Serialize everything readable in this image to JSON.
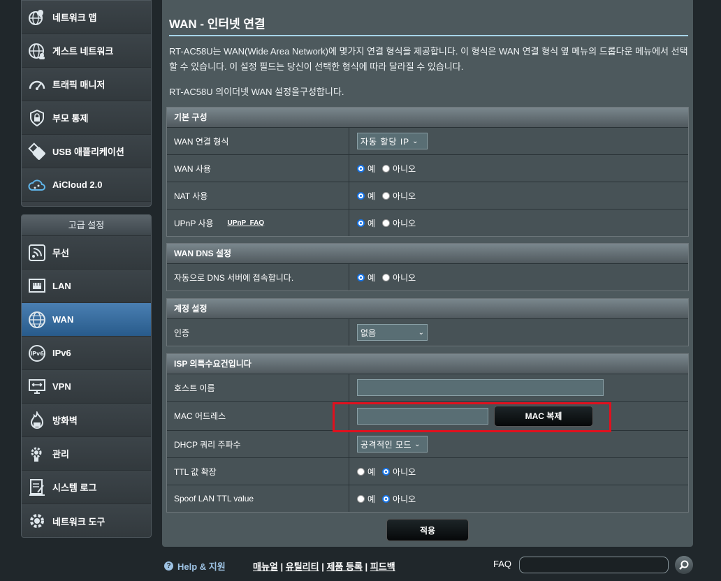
{
  "sidebar": {
    "general_items": [
      {
        "label": "네트워크 맵",
        "icon": "network-map-icon"
      },
      {
        "label": "게스트 네트워크",
        "icon": "guest-network-icon"
      },
      {
        "label": "트래픽 매니저",
        "icon": "traffic-manager-icon"
      },
      {
        "label": "부모 통제",
        "icon": "parental-control-icon"
      },
      {
        "label": "USB 애플리케이션",
        "icon": "usb-application-icon"
      },
      {
        "label": "AiCloud 2.0",
        "icon": "aicloud-icon"
      }
    ],
    "advanced_header": "고급 설정",
    "advanced_items": [
      {
        "label": "무선",
        "icon": "wireless-icon"
      },
      {
        "label": "LAN",
        "icon": "lan-icon"
      },
      {
        "label": "WAN",
        "icon": "wan-globe-icon",
        "active": true
      },
      {
        "label": "IPv6",
        "icon": "ipv6-icon"
      },
      {
        "label": "VPN",
        "icon": "vpn-icon"
      },
      {
        "label": "방화벽",
        "icon": "firewall-icon"
      },
      {
        "label": "관리",
        "icon": "administration-icon"
      },
      {
        "label": "시스템 로그",
        "icon": "system-log-icon"
      },
      {
        "label": "네트워크 도구",
        "icon": "network-tools-icon"
      }
    ]
  },
  "main": {
    "title": "WAN - 인터넷 연결",
    "description": "RT-AC58U는 WAN(Wide Area Network)에 몇가지 연결 형식을 제공합니다. 이 형식은 WAN 연결 형식 옆 메뉴의 드롭다운 메뉴에서 선택할 수 있습니다. 이 설정 필드는 당신이 선택한 형식에 따라 달라질 수 있습니다.",
    "subdescription": "RT-AC58U 의이더넷 WAN 설정을구성합니다.",
    "basic": {
      "header": "기본 구성",
      "wan_type_label": "WAN 연결 형식",
      "wan_type_value": "자동 할당 IP",
      "wan_enable_label": "WAN 사용",
      "nat_label": "NAT 사용",
      "upnp_label": "UPnP 사용",
      "upnp_faq": "UPnP  FAQ"
    },
    "dns": {
      "header": "WAN DNS 설정",
      "auto_dns_label": "자동으로 DNS 서버에 접속합니다."
    },
    "account": {
      "header": "계정 설정",
      "auth_label": "인증",
      "auth_value": "없음"
    },
    "isp": {
      "header": "ISP 의특수요건입니다",
      "hostname_label": "호스트 이름",
      "hostname_value": "",
      "mac_label": "MAC 어드레스",
      "mac_value": "",
      "mac_clone_button": "MAC 복제",
      "dhcp_label": "DHCP 쿼리 주파수",
      "dhcp_value": "공격적인 모드",
      "ttl_label": "TTL 값 확장",
      "spoof_label": "Spoof LAN TTL value"
    },
    "radio_yes": "예",
    "radio_no": "아니오",
    "apply_button": "적용"
  },
  "footer": {
    "help": "Help & 지원",
    "manual": "매뉴얼",
    "utility": "유틸리티",
    "register": "제품 등록",
    "feedback": "피드백",
    "faq_label": "FAQ",
    "faq_placeholder": ""
  },
  "colors": {
    "accent": "#1673e6",
    "active_menu": "#3a6fa2",
    "highlight": "#e0101e"
  }
}
